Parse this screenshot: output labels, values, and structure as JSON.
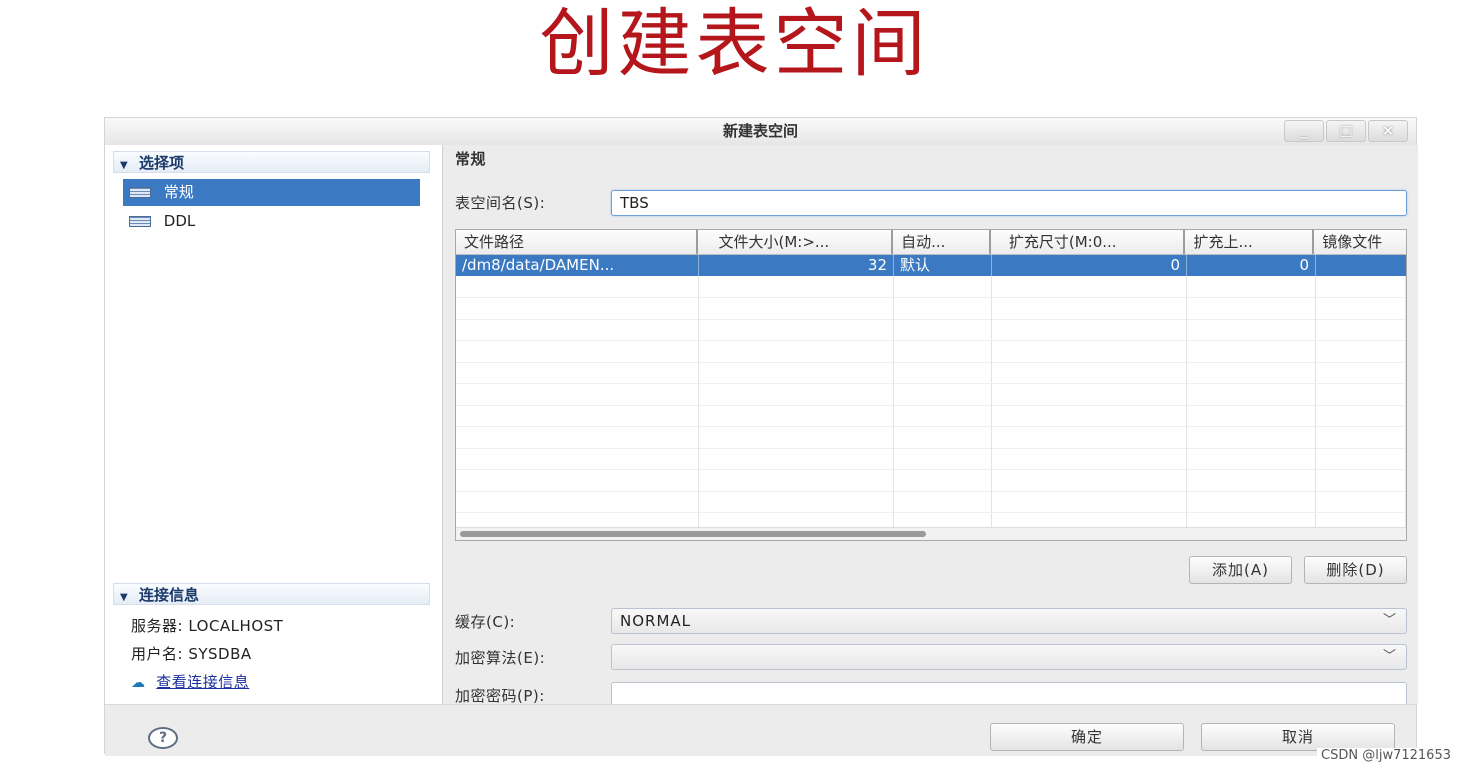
{
  "headline": "创建表空间",
  "window": {
    "title": "新建表空间",
    "controls": {
      "minimize": "_",
      "maximize": "□",
      "close": "×"
    }
  },
  "sidebar": {
    "select_header": "选择项",
    "items": [
      {
        "label": "常规",
        "selected": true
      },
      {
        "label": "DDL",
        "selected": false
      }
    ],
    "connection_header": "连接信息",
    "server_label": "服务器: LOCALHOST",
    "user_label": "用户名: SYSDBA",
    "view_link": "查看连接信息"
  },
  "main": {
    "section_title": "常规",
    "name_label": "表空间名(S):",
    "name_value": "TBS",
    "table": {
      "headers": [
        "文件路径",
        "文件大小(M:>...",
        "自动...",
        "扩充尺寸(M:0...",
        "扩充上...",
        "镜像文件"
      ],
      "rows": [
        [
          "/dm8/data/DAMEN...",
          "32",
          "默认",
          "0",
          "0",
          ""
        ]
      ]
    },
    "add_button": "添加(A)",
    "delete_button": "删除(D)",
    "cache_label": "缓存(C):",
    "cache_value": "NORMAL",
    "encrypt_algo_label": "加密算法(E):",
    "encrypt_algo_value": "",
    "encrypt_pwd_label": "加密密码(P):",
    "encrypt_pwd_value": ""
  },
  "footer": {
    "help_icon": "question-icon",
    "help_glyph": "?",
    "ok_button": "确定",
    "cancel_button": "取消"
  },
  "watermark": "CSDN @ljw7121653",
  "colors": {
    "headline": "#b4161b",
    "selection": "#3b79c2"
  }
}
